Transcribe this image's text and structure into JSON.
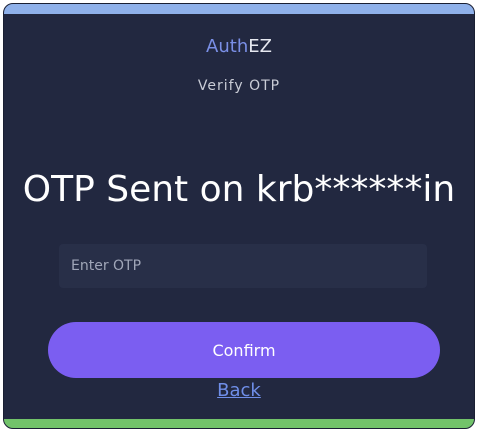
{
  "brand": {
    "part1": "Auth",
    "part2": "EZ"
  },
  "page": {
    "subtitle": "Verify OTP",
    "heading": "OTP Sent on krb******in"
  },
  "form": {
    "otp_placeholder": "Enter OTP",
    "otp_value": "",
    "confirm_label": "Confirm",
    "back_label": "Back"
  },
  "colors": {
    "background": "#222840",
    "accent_top": "#8fb1ea",
    "accent_bottom": "#72c36a",
    "button": "#7b5ef1",
    "link": "#6f8ee8",
    "brand_accent": "#7a8fe6"
  }
}
